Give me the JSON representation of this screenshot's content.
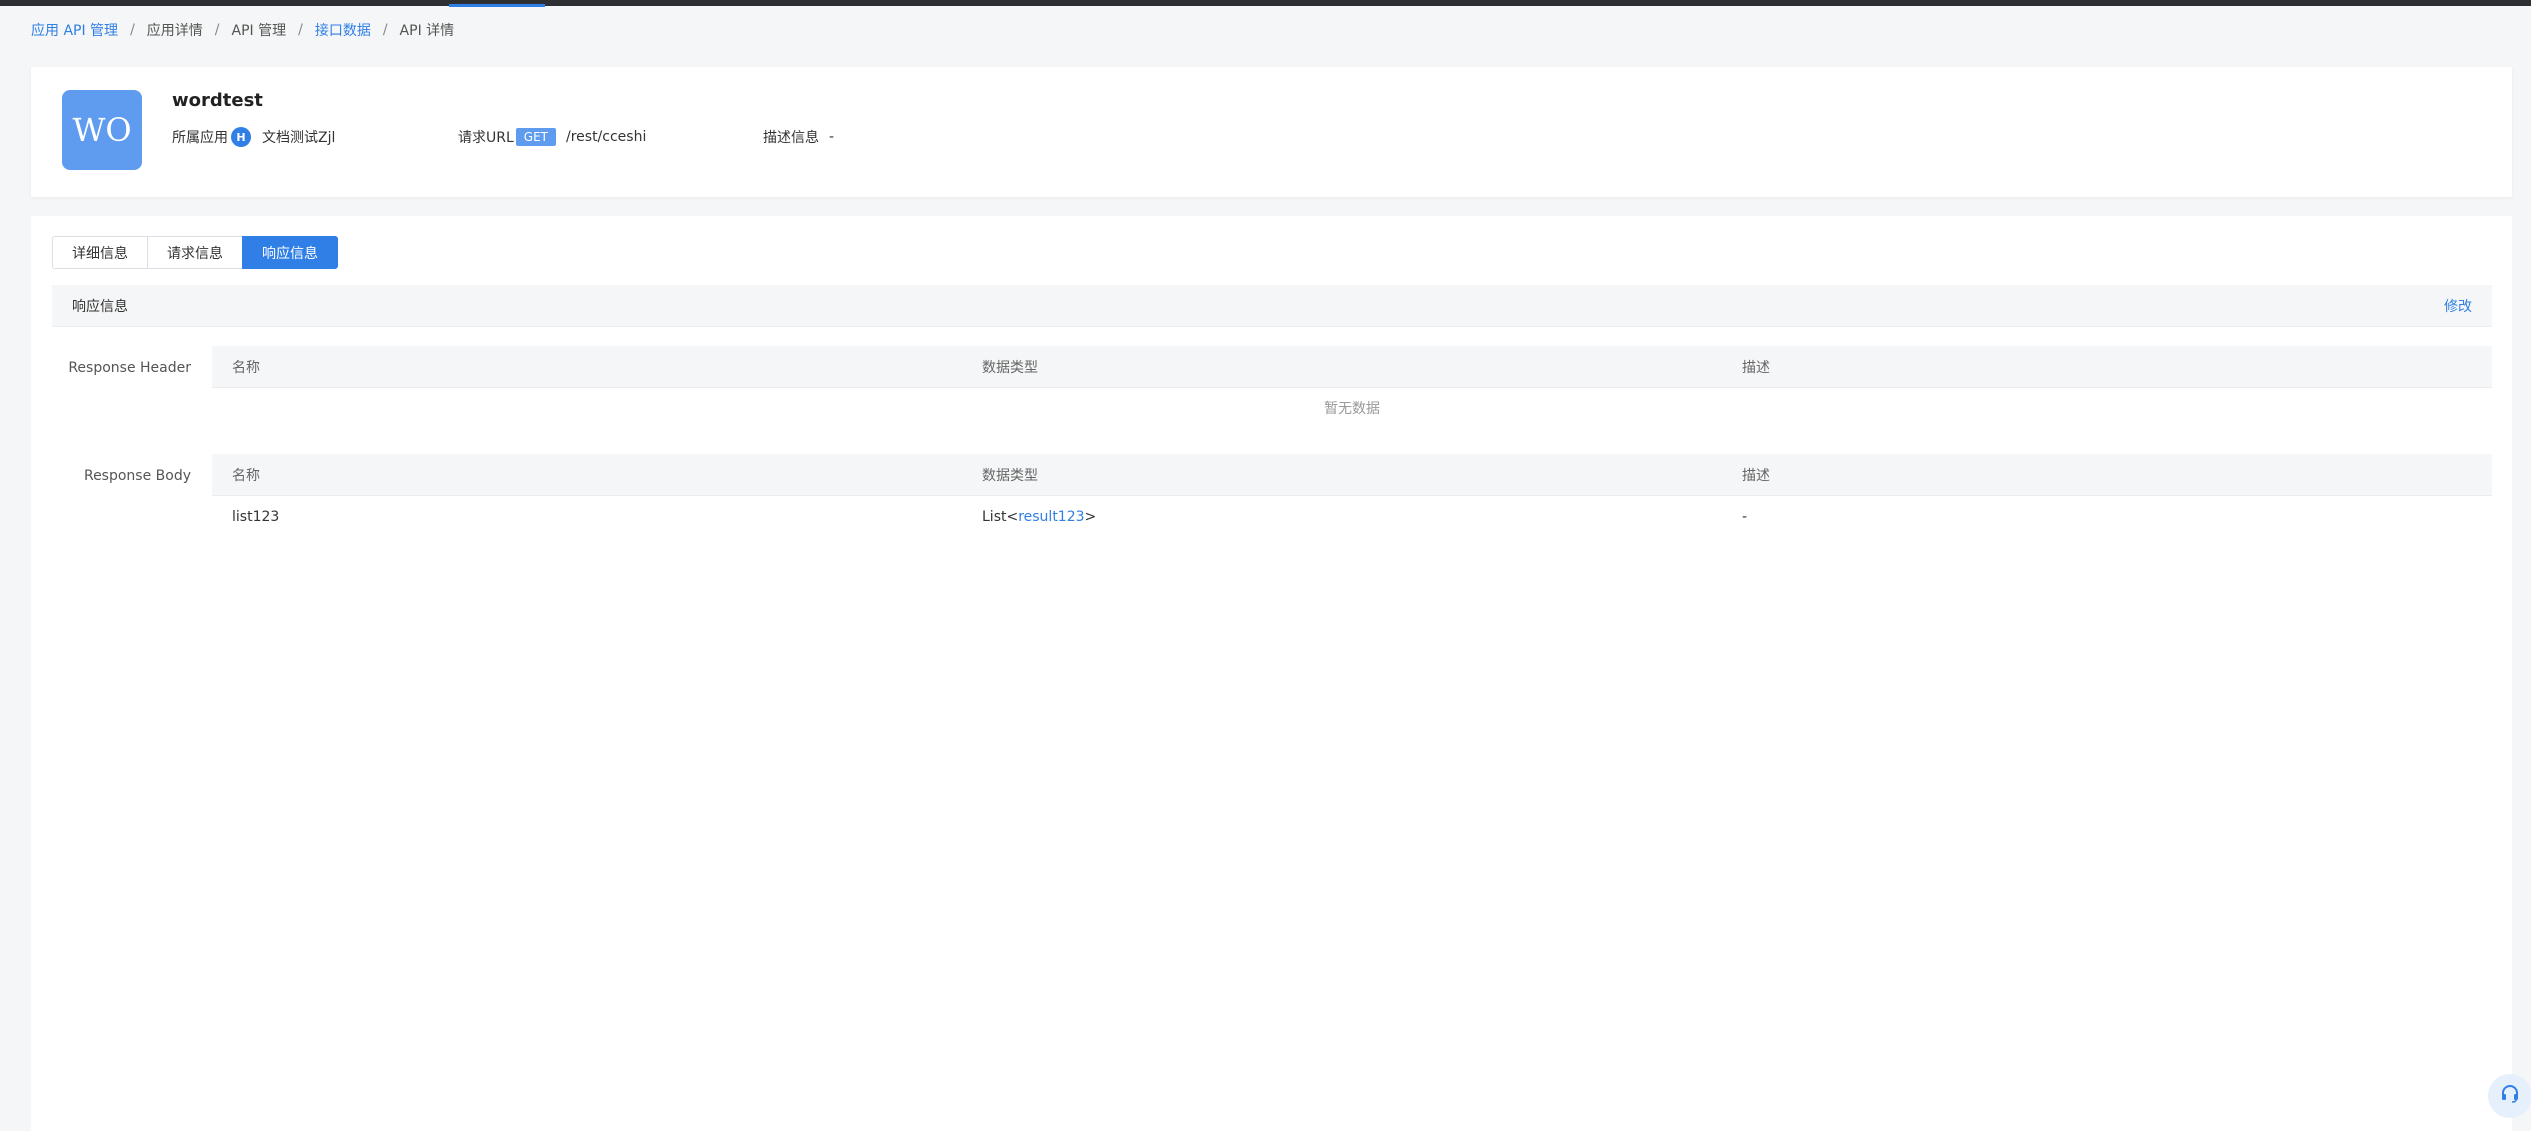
{
  "breadcrumb": [
    {
      "label": "应用 API 管理",
      "link": true
    },
    {
      "label": "应用详情",
      "link": false
    },
    {
      "label": "API 管理",
      "link": false
    },
    {
      "label": "接口数据",
      "link": true
    },
    {
      "label": "API 详情",
      "link": false
    }
  ],
  "breadcrumb_separator": "/",
  "api": {
    "avatar_text": "WO",
    "name": "wordtest",
    "app_label": "所属应用",
    "app_badge": "H",
    "app_name": "文档测试Zjl",
    "url_label": "请求URL",
    "method": "GET",
    "url": "/rest/cceshi",
    "desc_label": "描述信息",
    "desc_value": "-"
  },
  "tabs": [
    "详细信息",
    "请求信息",
    "响应信息"
  ],
  "active_tab": 2,
  "section": {
    "title": "响应信息",
    "edit_label": "修改"
  },
  "response_header": {
    "label": "Response Header",
    "columns": [
      "名称",
      "数据类型",
      "描述"
    ],
    "empty_text": "暂无数据"
  },
  "response_body": {
    "label": "Response Body",
    "columns": [
      "名称",
      "数据类型",
      "描述"
    ],
    "rows": [
      {
        "name": "list123",
        "type_prefix": "List<",
        "type_link": "result123",
        "type_suffix": ">",
        "desc": "-"
      }
    ]
  },
  "colors": {
    "accent": "#2f7fe6",
    "avatar": "#5f9cf0",
    "topbar": "#2d2f33"
  },
  "icons": {
    "help": "headset-icon"
  }
}
